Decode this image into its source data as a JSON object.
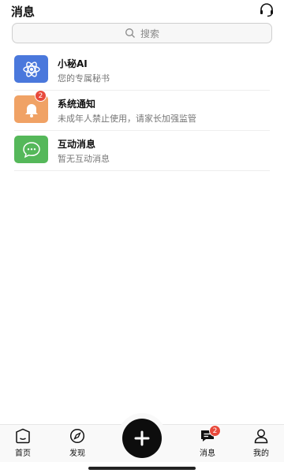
{
  "header": {
    "title": "消息",
    "support_icon": "headset-icon"
  },
  "search": {
    "placeholder": "搜索",
    "icon": "search-icon"
  },
  "messages": [
    {
      "title": "小秘AI",
      "subtitle": "您的专属秘书",
      "icon": "atom-icon",
      "color": "#4a78dc",
      "badge": ""
    },
    {
      "title": "系统通知",
      "subtitle": "未成年人禁止使用，请家长加强监管",
      "icon": "bell-icon",
      "color": "#f0a265",
      "badge": "2"
    },
    {
      "title": "互动消息",
      "subtitle": "暂无互动消息",
      "icon": "chat-bubble-icon",
      "color": "#55b85a",
      "badge": ""
    }
  ],
  "nav": {
    "items": [
      {
        "label": "首页",
        "icon": "home-icon"
      },
      {
        "label": "发现",
        "icon": "compass-icon"
      },
      {
        "label": "消息",
        "icon": "message-icon",
        "badge": "2"
      },
      {
        "label": "我的",
        "icon": "profile-icon"
      }
    ],
    "fab_icon": "plus-icon"
  }
}
